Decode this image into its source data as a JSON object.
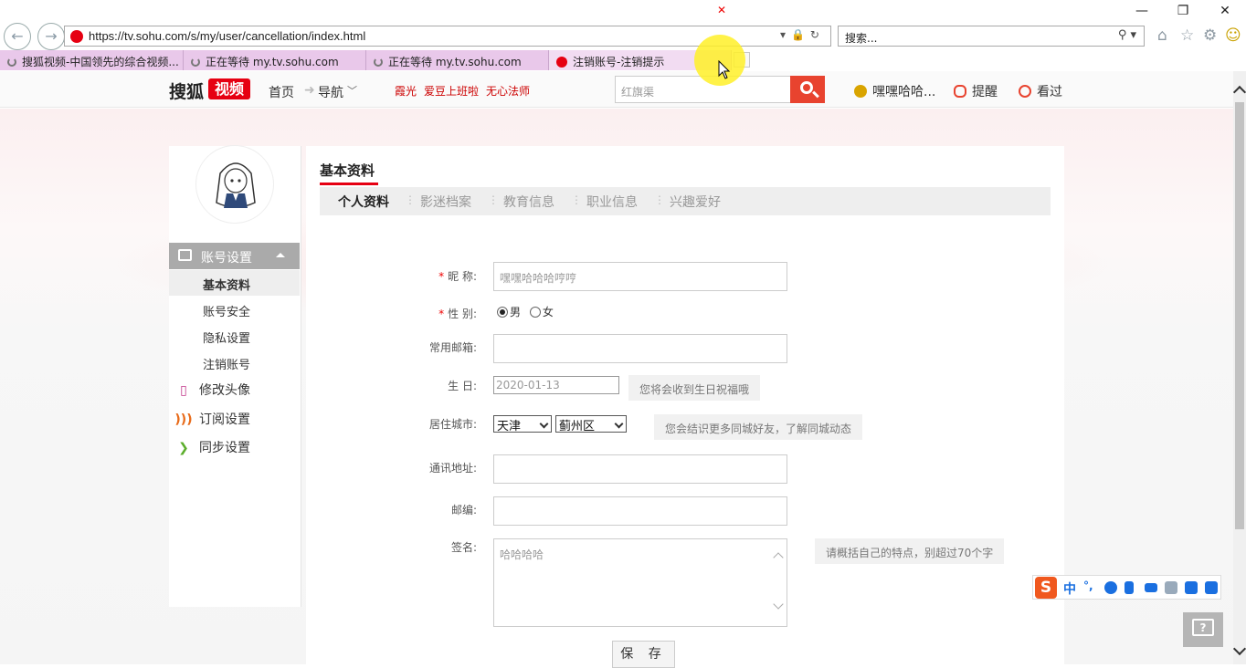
{
  "browser": {
    "window_controls": [
      "—",
      "❐",
      "✕"
    ],
    "url": "https://tv.sohu.com/s/my/user/cancellation/index.html",
    "search_placeholder": "搜索...",
    "tabs": [
      {
        "label": "搜狐视频-中国领先的综合视频...",
        "loading": true
      },
      {
        "label": "正在等待 my.tv.sohu.com",
        "loading": true
      },
      {
        "label": "正在等待 my.tv.sohu.com",
        "loading": true
      },
      {
        "label": "注销账号-注销提示",
        "active": true
      }
    ],
    "tab_close_glyph": "✕",
    "icons": [
      "home-icon",
      "star-icon",
      "gear-icon",
      "smiley-icon"
    ]
  },
  "header": {
    "logo_text": "搜狐",
    "logo_badge": "视频",
    "nav": [
      "首页",
      "导航"
    ],
    "hot_links": [
      "霞光",
      "爱豆上班啦",
      "无心法师"
    ],
    "search_placeholder": "红旗渠",
    "user": {
      "name": "嘿嘿哈哈...",
      "remind": "提醒",
      "history": "看过"
    }
  },
  "sidebar": {
    "section": "账号设置",
    "sub_items": [
      "基本资料",
      "账号安全",
      "隐私设置",
      "注销账号"
    ],
    "main_items": [
      "修改头像",
      "订阅设置",
      "同步设置"
    ]
  },
  "main": {
    "title": "基本资料",
    "tabs": [
      "个人资料",
      "影迷档案",
      "教育信息",
      "职业信息",
      "兴趣爱好"
    ],
    "form": {
      "nickname_label": "昵 称:",
      "nickname_value": "嘿嘿哈哈哈哼哼",
      "gender_label": "性 别:",
      "gender_male": "男",
      "gender_female": "女",
      "email_label": "常用邮箱:",
      "birthday_label": "生 日:",
      "birthday_value": "2020-01-13",
      "birthday_hint": "您将会收到生日祝福哦",
      "city_label": "居住城市:",
      "city_province": "天津",
      "city_district": "蓟州区",
      "city_hint": "您会结识更多同城好友，了解同城动态",
      "address_label": "通讯地址:",
      "postcode_label": "邮编:",
      "signature_label": "签名:",
      "signature_value": "哈哈哈哈",
      "signature_hint": "请概括自己的特点，别超过70个字",
      "required_mark": "*",
      "save": "保 存"
    }
  },
  "ime": {
    "logo": "S",
    "lang": "中",
    "punct": "°,"
  },
  "help_fab": "?",
  "colors": {
    "brand_red": "#e60012",
    "search_red": "#e8432f",
    "tab_pink": "#e9c8ea",
    "ime_blue": "#1a6fe0"
  }
}
